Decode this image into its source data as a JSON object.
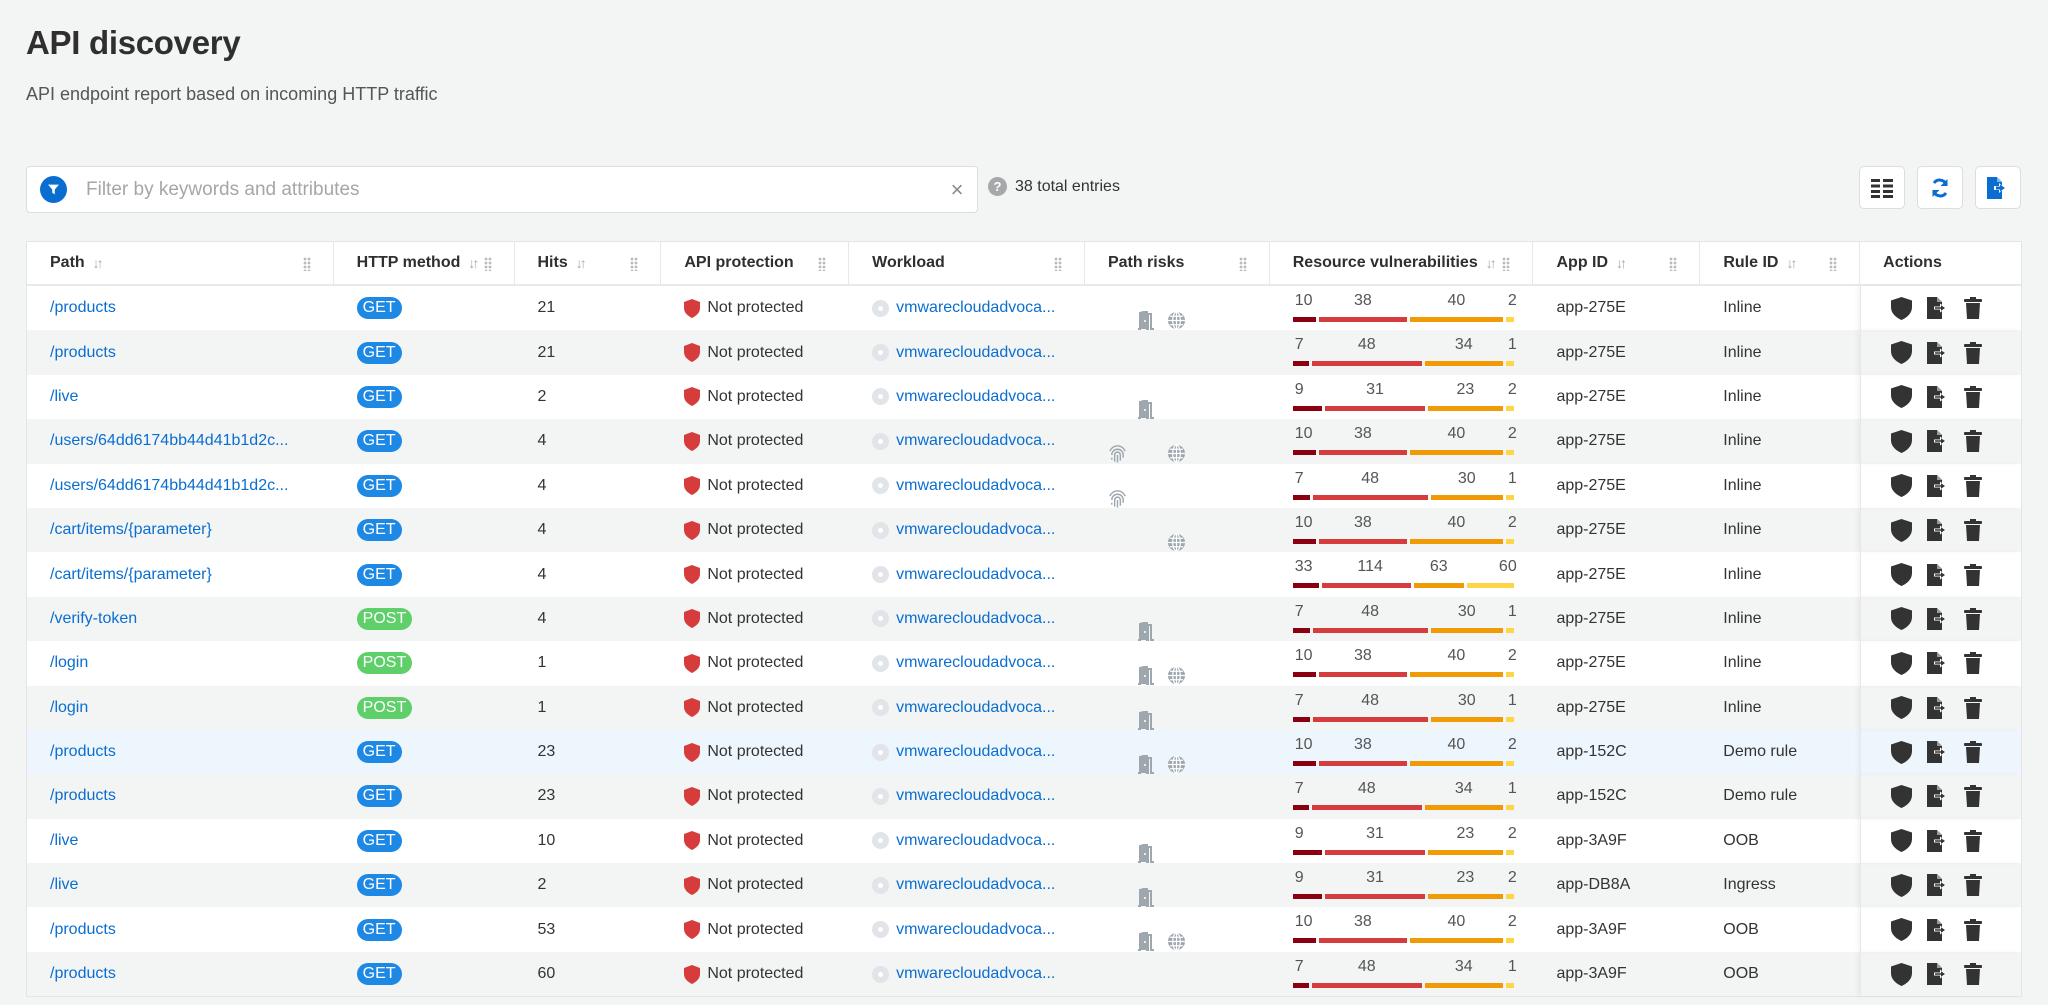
{
  "header": {
    "title": "API discovery",
    "subtitle": "API endpoint report based on incoming HTTP traffic"
  },
  "filter": {
    "placeholder": "Filter by keywords and attributes",
    "value": "",
    "total_entries": "38 total entries"
  },
  "toolbar": {
    "buttons": [
      "columns-icon",
      "refresh-icon",
      "export-icon"
    ]
  },
  "colors": {
    "accent": "#0a6ed1",
    "get": "#1e88e5",
    "post": "#5fcf6a",
    "critical": "#8b0011",
    "high": "#d63c3c",
    "medium": "#f09a05",
    "low": "#fdd547"
  },
  "columns": [
    {
      "label": "Path",
      "sortable": true
    },
    {
      "label": "HTTP method",
      "sortable": true
    },
    {
      "label": "Hits",
      "sortable": true
    },
    {
      "label": "API protection",
      "sortable": false
    },
    {
      "label": "Workload",
      "sortable": false
    },
    {
      "label": "Path risks",
      "sortable": false
    },
    {
      "label": "Resource vulnerabilities",
      "sortable": true
    },
    {
      "label": "App ID",
      "sortable": true
    },
    {
      "label": "Rule ID",
      "sortable": true
    },
    {
      "label": "Actions",
      "sortable": false
    }
  ],
  "rows": [
    {
      "path": "/products",
      "method": "GET",
      "hits": "21",
      "protection": "Not protected",
      "workload": "vmwarecloudadvoca...",
      "risks": [
        "door",
        "globe"
      ],
      "vulns": [
        10,
        38,
        40,
        2
      ],
      "app_id": "app-275E",
      "rule_id": "Inline"
    },
    {
      "path": "/products",
      "method": "GET",
      "hits": "21",
      "protection": "Not protected",
      "workload": "vmwarecloudadvoca...",
      "risks": [],
      "vulns": [
        7,
        48,
        34,
        1
      ],
      "app_id": "app-275E",
      "rule_id": "Inline"
    },
    {
      "path": "/live",
      "method": "GET",
      "hits": "2",
      "protection": "Not protected",
      "workload": "vmwarecloudadvoca...",
      "risks": [
        "door"
      ],
      "vulns": [
        9,
        31,
        23,
        2
      ],
      "app_id": "app-275E",
      "rule_id": "Inline"
    },
    {
      "path": "/users/64dd6174bb44d41b1d2c...",
      "method": "GET",
      "hits": "4",
      "protection": "Not protected",
      "workload": "vmwarecloudadvoca...",
      "risks": [
        "fingerprint",
        "globe"
      ],
      "vulns": [
        10,
        38,
        40,
        2
      ],
      "app_id": "app-275E",
      "rule_id": "Inline"
    },
    {
      "path": "/users/64dd6174bb44d41b1d2c...",
      "method": "GET",
      "hits": "4",
      "protection": "Not protected",
      "workload": "vmwarecloudadvoca...",
      "risks": [
        "fingerprint"
      ],
      "vulns": [
        7,
        48,
        30,
        1
      ],
      "app_id": "app-275E",
      "rule_id": "Inline"
    },
    {
      "path": "/cart/items/{parameter}",
      "method": "GET",
      "hits": "4",
      "protection": "Not protected",
      "workload": "vmwarecloudadvoca...",
      "risks": [
        "globe"
      ],
      "vulns": [
        10,
        38,
        40,
        2
      ],
      "app_id": "app-275E",
      "rule_id": "Inline"
    },
    {
      "path": "/cart/items/{parameter}",
      "method": "GET",
      "hits": "4",
      "protection": "Not protected",
      "workload": "vmwarecloudadvoca...",
      "risks": [],
      "vulns": [
        33,
        114,
        63,
        60
      ],
      "app_id": "app-275E",
      "rule_id": "Inline"
    },
    {
      "path": "/verify-token",
      "method": "POST",
      "hits": "4",
      "protection": "Not protected",
      "workload": "vmwarecloudadvoca...",
      "risks": [
        "door"
      ],
      "vulns": [
        7,
        48,
        30,
        1
      ],
      "app_id": "app-275E",
      "rule_id": "Inline"
    },
    {
      "path": "/login",
      "method": "POST",
      "hits": "1",
      "protection": "Not protected",
      "workload": "vmwarecloudadvoca...",
      "risks": [
        "door",
        "globe"
      ],
      "vulns": [
        10,
        38,
        40,
        2
      ],
      "app_id": "app-275E",
      "rule_id": "Inline"
    },
    {
      "path": "/login",
      "method": "POST",
      "hits": "1",
      "protection": "Not protected",
      "workload": "vmwarecloudadvoca...",
      "risks": [
        "door"
      ],
      "vulns": [
        7,
        48,
        30,
        1
      ],
      "app_id": "app-275E",
      "rule_id": "Inline"
    },
    {
      "path": "/products",
      "method": "GET",
      "hits": "23",
      "protection": "Not protected",
      "workload": "vmwarecloudadvoca...",
      "risks": [
        "door",
        "globe"
      ],
      "vulns": [
        10,
        38,
        40,
        2
      ],
      "app_id": "app-152C",
      "rule_id": "Demo rule",
      "highlighted": true
    },
    {
      "path": "/products",
      "method": "GET",
      "hits": "23",
      "protection": "Not protected",
      "workload": "vmwarecloudadvoca...",
      "risks": [],
      "vulns": [
        7,
        48,
        34,
        1
      ],
      "app_id": "app-152C",
      "rule_id": "Demo rule"
    },
    {
      "path": "/live",
      "method": "GET",
      "hits": "10",
      "protection": "Not protected",
      "workload": "vmwarecloudadvoca...",
      "risks": [
        "door"
      ],
      "vulns": [
        9,
        31,
        23,
        2
      ],
      "app_id": "app-3A9F",
      "rule_id": "OOB"
    },
    {
      "path": "/live",
      "method": "GET",
      "hits": "2",
      "protection": "Not protected",
      "workload": "vmwarecloudadvoca...",
      "risks": [
        "door"
      ],
      "vulns": [
        9,
        31,
        23,
        2
      ],
      "app_id": "app-DB8A",
      "rule_id": "Ingress"
    },
    {
      "path": "/products",
      "method": "GET",
      "hits": "53",
      "protection": "Not protected",
      "workload": "vmwarecloudadvoca...",
      "risks": [
        "door",
        "globe"
      ],
      "vulns": [
        10,
        38,
        40,
        2
      ],
      "app_id": "app-3A9F",
      "rule_id": "OOB"
    },
    {
      "path": "/products",
      "method": "GET",
      "hits": "60",
      "protection": "Not protected",
      "workload": "vmwarecloudadvoca...",
      "risks": [],
      "vulns": [
        7,
        48,
        34,
        1
      ],
      "app_id": "app-3A9F",
      "rule_id": "OOB"
    }
  ]
}
